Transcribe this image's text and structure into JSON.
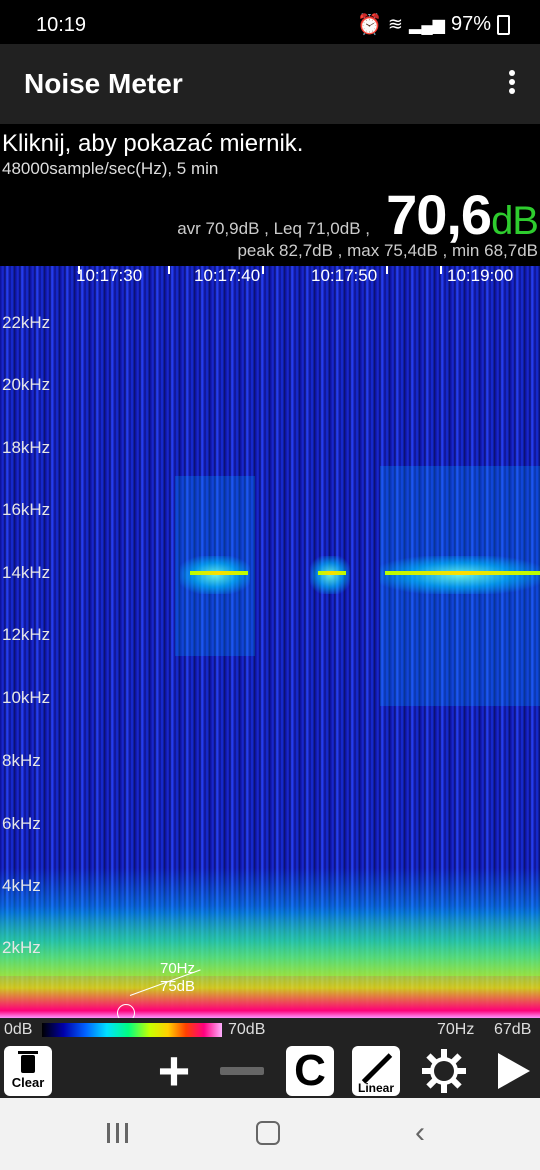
{
  "status_bar": {
    "time": "10:19",
    "battery": "97%",
    "icons": [
      "alarm-icon",
      "wifi-icon",
      "signal-icon",
      "battery-icon"
    ]
  },
  "app_bar": {
    "title": "Noise Meter",
    "menu_icon": "more-vert-icon"
  },
  "info": {
    "prompt": "Kliknij, aby pokazać miernik.",
    "sample_info": "48000sample/sec(Hz), 5 min",
    "stats_line1": "avr 70,9dB , Leq 71,0dB ,",
    "current_value": "70,6",
    "current_unit": "dB",
    "stats_line2": "peak 82,7dB , max 75,4dB , min 68,7dB",
    "value_color": "#2ecc2e"
  },
  "spectrogram": {
    "time_labels": [
      "10:17:30",
      "10:17:40",
      "10:17:50",
      "10:19:00"
    ],
    "freq_labels": [
      "22kHz",
      "20kHz",
      "18kHz",
      "16kHz",
      "14kHz",
      "12kHz",
      "10kHz",
      "8kHz",
      "6kHz",
      "4kHz",
      "2kHz"
    ],
    "peak_freq": "70Hz",
    "peak_level": "75dB"
  },
  "legend": {
    "min_label": "0dB",
    "max_label": "70dB",
    "freq_readout": "70Hz",
    "level_readout": "67dB"
  },
  "toolbar": {
    "clear_label": "Clear",
    "c_label": "C",
    "linear_label": "Linear",
    "plus_label": "+",
    "icons": [
      "trash-icon",
      "plus-icon",
      "minus-icon",
      "c-icon",
      "linear-icon",
      "gear-icon",
      "play-icon"
    ]
  },
  "nav": {
    "icons": [
      "recents-icon",
      "home-icon",
      "back-icon"
    ]
  }
}
